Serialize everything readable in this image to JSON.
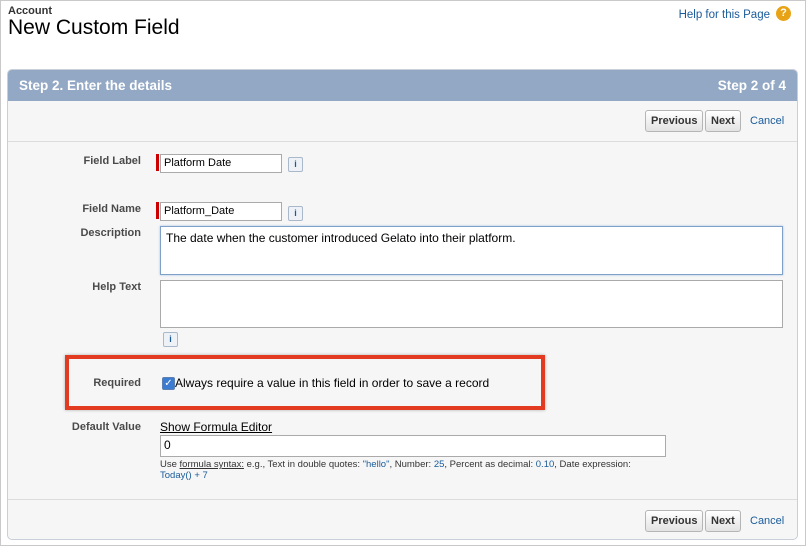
{
  "header": {
    "breadcrumb": "Account",
    "title": "New Custom Field",
    "help_link": "Help for this Page",
    "help_icon": "question-circle-icon"
  },
  "panel": {
    "step_title": "Step 2. Enter the details",
    "step_count": "Step 2 of 4",
    "buttons": {
      "previous": "Previous",
      "next": "Next",
      "cancel": "Cancel"
    }
  },
  "form": {
    "field_label": {
      "label": "Field Label",
      "value": "Platform Date"
    },
    "field_name": {
      "label": "Field Name",
      "value": "Platform_Date"
    },
    "description": {
      "label": "Description",
      "value": "The date when the customer introduced Gelato into their platform."
    },
    "help_text": {
      "label": "Help Text",
      "value": ""
    },
    "required": {
      "label": "Required",
      "checked": true,
      "text": "Always require a value in this field in order to save a record"
    },
    "default_value": {
      "label": "Default Value",
      "show_formula_editor": "Show Formula Editor",
      "value": "0",
      "hint_use": "Use",
      "hint_link": "formula syntax:",
      "hint_text1": " e.g., Text in double quotes: ",
      "hint_hello": "\"hello\"",
      "hint_text2": ", Number: ",
      "hint_number": "25",
      "hint_text3": ", Percent as decimal: ",
      "hint_percent": "0.10",
      "hint_text4": ", Date expression:",
      "hint_date": "Today() + 7"
    },
    "info_icon": "i"
  },
  "colors": {
    "panel_header": "#93a8c4",
    "highlight_box": "#e33a22",
    "required_bar": "#cc0000",
    "link": "#1a5b9a"
  }
}
